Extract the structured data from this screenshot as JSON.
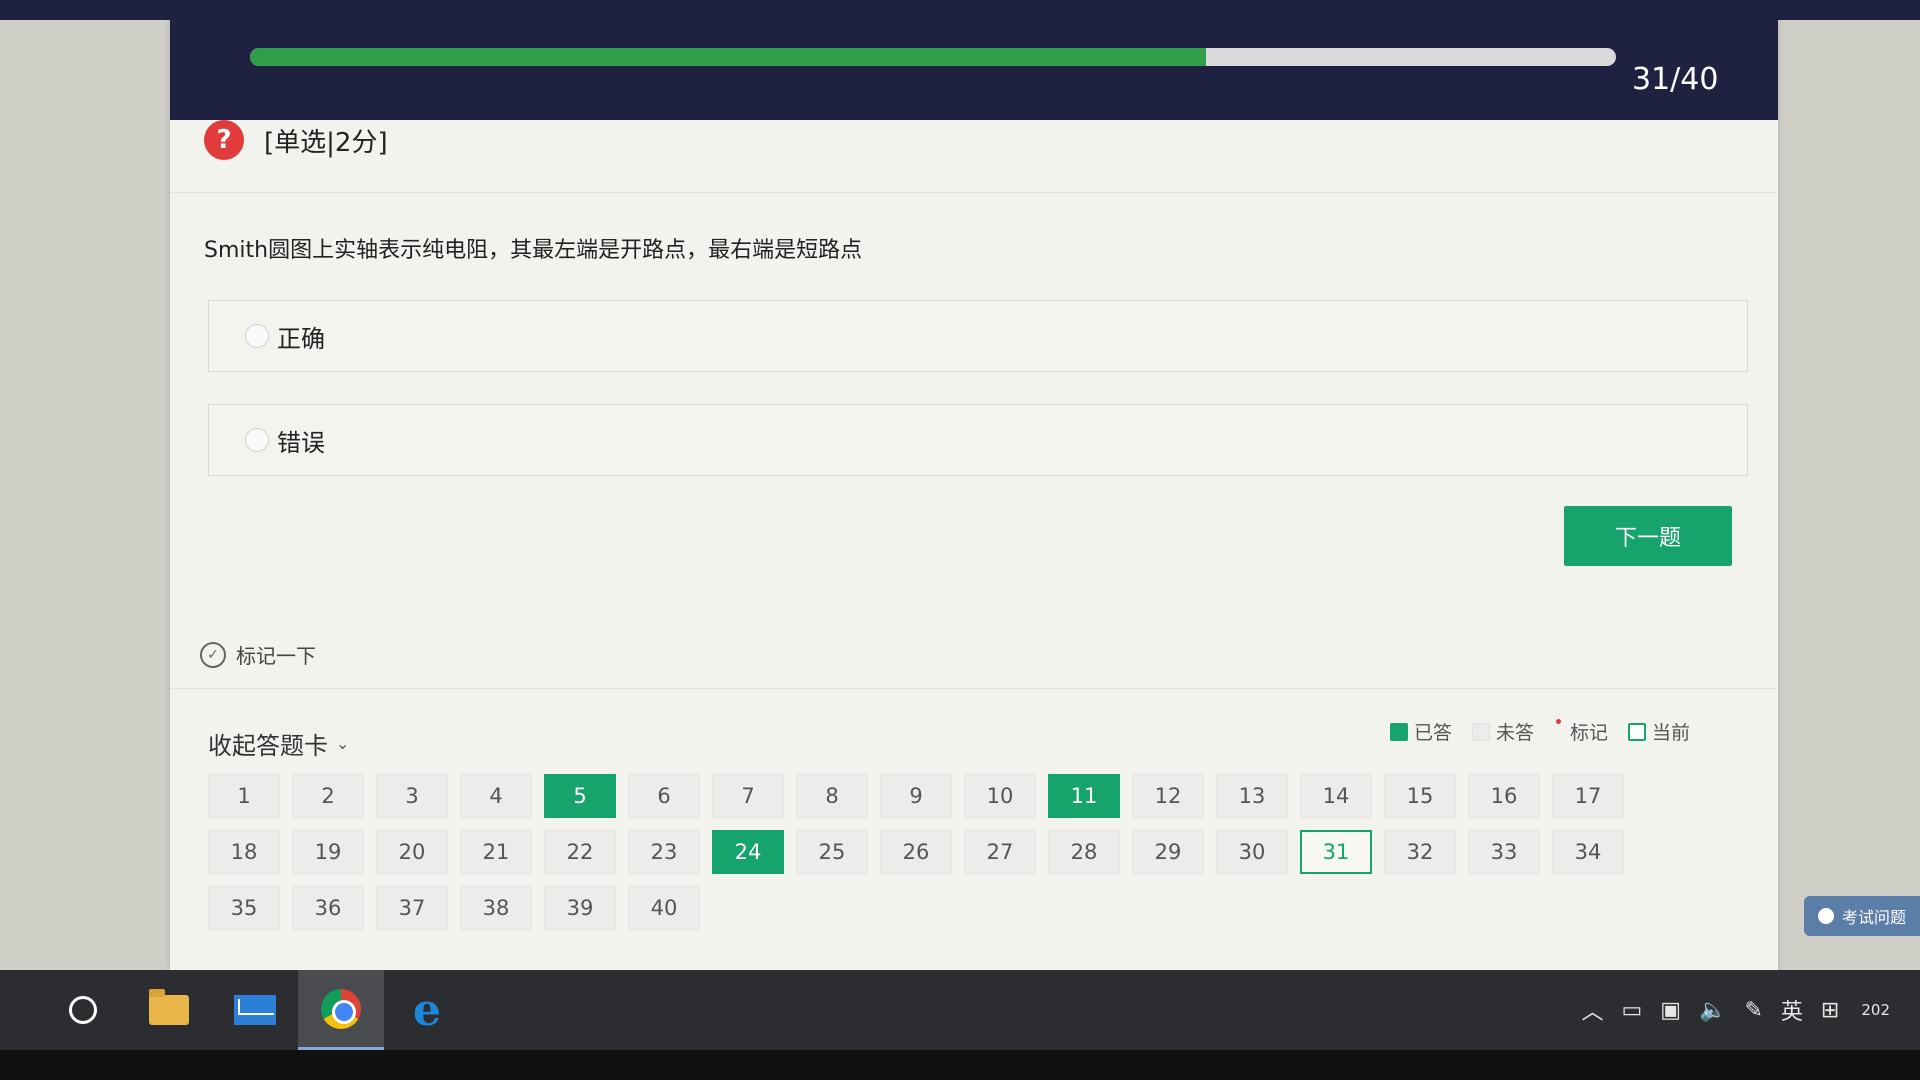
{
  "progress": {
    "count": "31/40",
    "fraction": 0.7
  },
  "question": {
    "type_label": "[单选|2分]",
    "text": "Smith圆图上实轴表示纯电阻，其最左端是开路点，最右端是短路点",
    "options": [
      "正确",
      "错误"
    ]
  },
  "next_button": "下一题",
  "mark_label": "标记一下",
  "card_toggle": "收起答题卡",
  "legend": {
    "answered": "已答",
    "unanswered": "未答",
    "marked": "标记",
    "current": "当前"
  },
  "answer_card": {
    "numbers": [
      "1",
      "2",
      "3",
      "4",
      "5",
      "6",
      "7",
      "8",
      "9",
      "10",
      "11",
      "12",
      "13",
      "14",
      "15",
      "16",
      "17",
      "18",
      "19",
      "20",
      "21",
      "22",
      "23",
      "24",
      "25",
      "26",
      "27",
      "28",
      "29",
      "30",
      "31",
      "32",
      "33",
      "34",
      "35",
      "36",
      "37",
      "38",
      "39",
      "40"
    ],
    "answered": [
      "5",
      "11",
      "24"
    ],
    "current": "31"
  },
  "feedback_tab": "考试问题",
  "taskbar": {
    "tray_lang": "英",
    "date_fragment": "202"
  },
  "colors": {
    "accent": "#17a36c",
    "header": "#1e2240",
    "progress_fill": "#2e9e4a",
    "question_icon": "#e23b3b"
  }
}
